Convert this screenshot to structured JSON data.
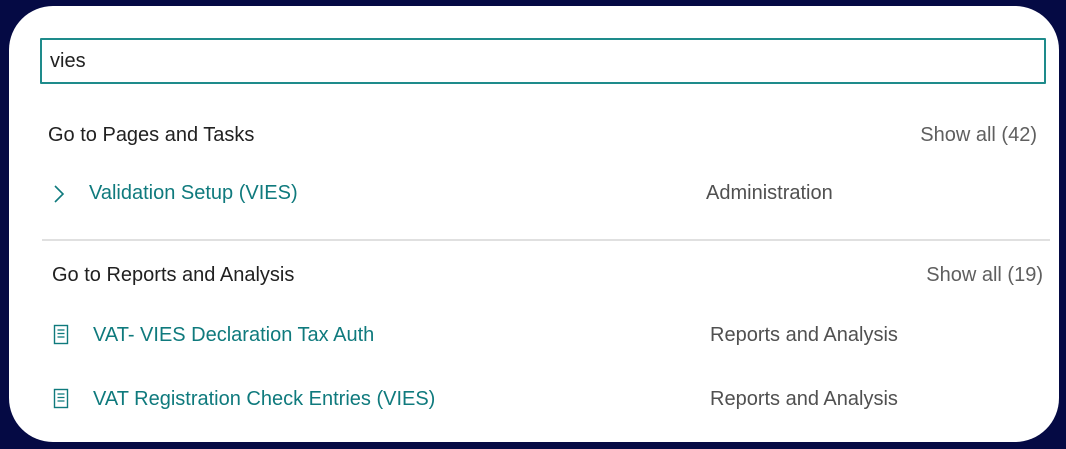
{
  "search": {
    "value": "vies"
  },
  "pages_group": {
    "header": "Go to Pages and Tasks",
    "show_all": "Show all (42)",
    "items": [
      {
        "title": "Validation Setup (VIES)",
        "category": "Administration",
        "icon": "chevron-right-icon"
      }
    ]
  },
  "reports_group": {
    "header": "Go to Reports and Analysis",
    "show_all": "Show all (19)",
    "items": [
      {
        "title": "VAT- VIES Declaration Tax Auth",
        "category": "Reports and Analysis",
        "icon": "report-document-icon"
      },
      {
        "title": "VAT Registration Check Entries (VIES)",
        "category": "Reports and Analysis",
        "icon": "report-document-icon"
      }
    ]
  },
  "colors": {
    "background": "#050a44",
    "accent": "#0f7a7d",
    "input_border": "#1e8b8b"
  }
}
